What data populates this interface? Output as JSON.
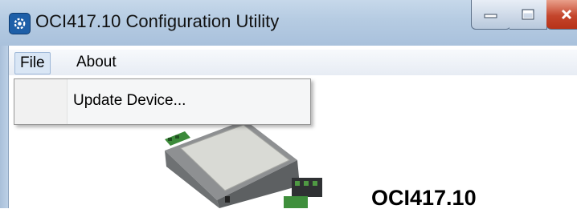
{
  "window": {
    "title": "OCI417.10 Configuration Utility",
    "icon": "app-gear-icon",
    "controls": [
      "minimize-icon",
      "maximize-icon",
      "close-icon"
    ],
    "close_color": "#c4452c"
  },
  "menubar": {
    "items": [
      {
        "label": "File"
      },
      {
        "label": "About"
      }
    ]
  },
  "file_menu": {
    "items": [
      {
        "label": "Update Device..."
      }
    ]
  },
  "main": {
    "product_name": "OCI417.10",
    "device_image": "device-module-image"
  }
}
